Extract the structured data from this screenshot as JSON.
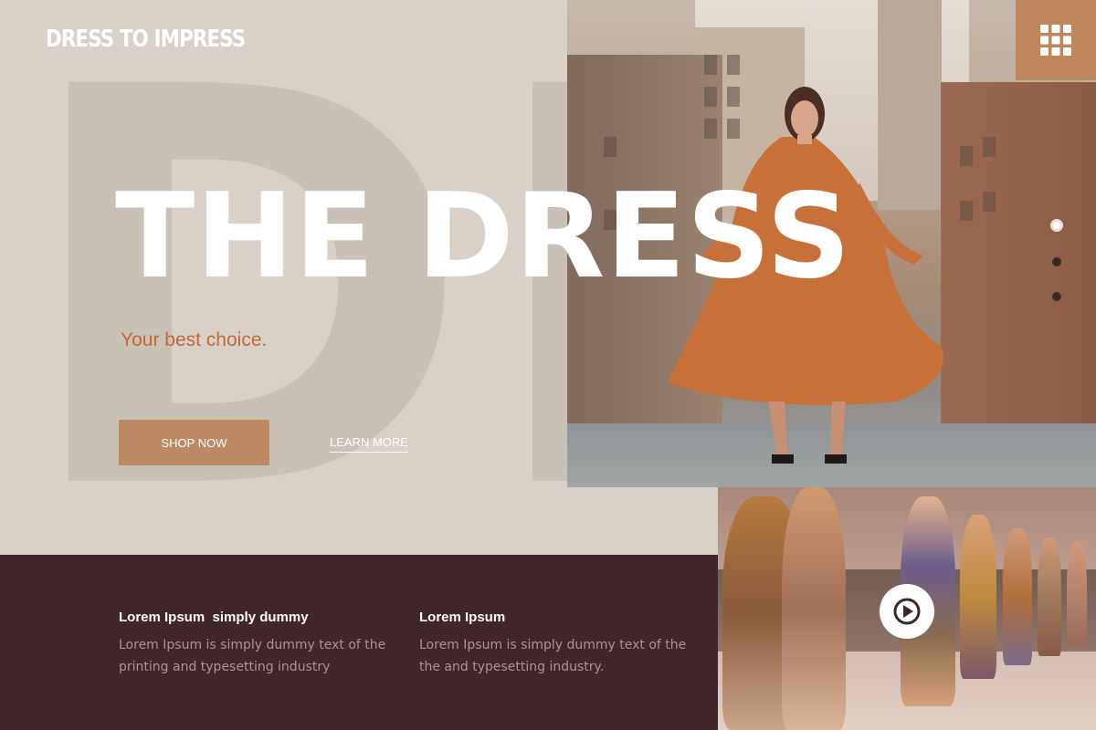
{
  "brand": {
    "name": "DRESS TO IMPRESS"
  },
  "hero": {
    "background_letters": "DR",
    "headline": "THE DRESS",
    "tagline": "Your best choice.",
    "primary_button": "SHOP NOW",
    "secondary_link": "LEARN MORE"
  },
  "menu": {
    "icon": "grid-menu-icon"
  },
  "slider": {
    "total": 3,
    "active": 1
  },
  "features": [
    {
      "title": "Lorem Ipsum  simply dummy",
      "text": "Lorem Ipsum is simply dummy text of the printing and typesetting industry"
    },
    {
      "title": "Lorem Ipsum",
      "text": "Lorem Ipsum is simply dummy text of the the and typesetting industry."
    }
  ],
  "video": {
    "icon": "play-icon"
  },
  "colors": {
    "page_bg": "#d9d1c8",
    "accent": "#bd8a63",
    "tagline": "#c0683a",
    "footer_bg": "#3f2628",
    "menu_tile": "#c0865c"
  }
}
